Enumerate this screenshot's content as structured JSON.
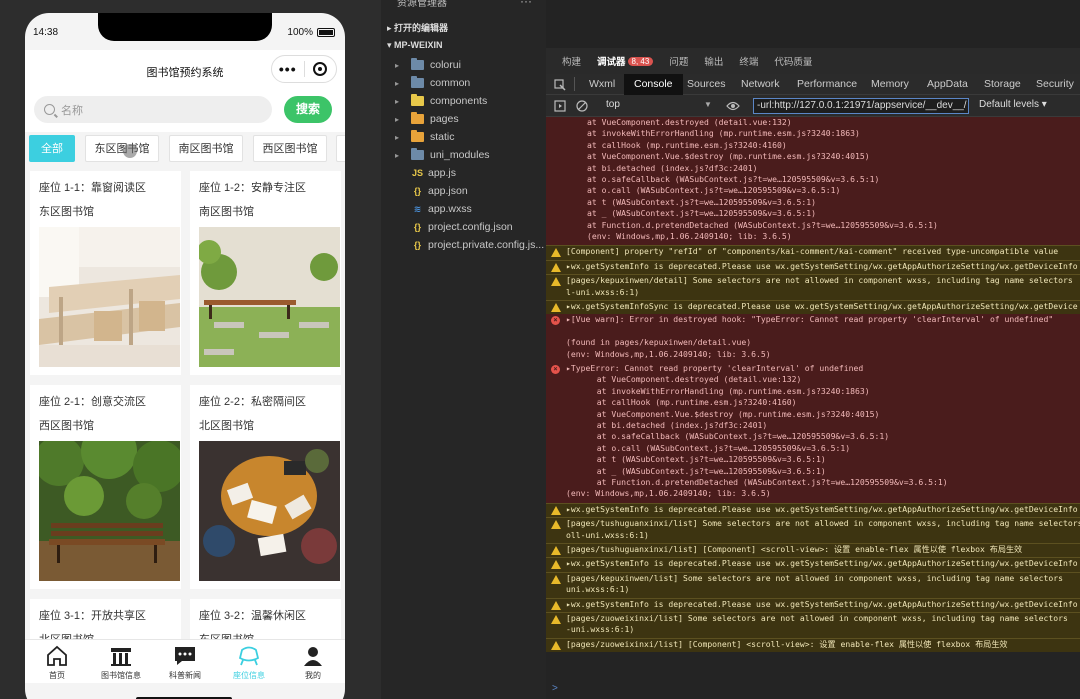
{
  "phone": {
    "time": "14:38",
    "battery": "100%",
    "title": "图书馆预约系统",
    "capsule_more": "•••",
    "search_placeholder": "名称",
    "search_button": "搜索",
    "chips": [
      "全部",
      "东区图书馆",
      "南区图书馆",
      "西区图书馆",
      ""
    ],
    "cards": [
      {
        "title": "座位 1-1：靠窗阅读区",
        "library": "东区图书馆",
        "image": "classroom-chairs"
      },
      {
        "title": "座位 1-2：安静专注区",
        "library": "南区图书馆",
        "image": "garden-bench"
      },
      {
        "title": "座位 2-1：创意交流区",
        "library": "西区图书馆",
        "image": "park-bench"
      },
      {
        "title": "座位 2-2：私密隔间区",
        "library": "北区图书馆",
        "image": "reading-circle"
      },
      {
        "title": "座位 3-1：开放共享区",
        "library": "北区图书馆",
        "image": ""
      },
      {
        "title": "座位 3-2：温馨休闲区",
        "library": "东区图书馆",
        "image": ""
      }
    ],
    "tabs": [
      {
        "label": "首页",
        "icon": "home-icon"
      },
      {
        "label": "图书馆信息",
        "icon": "library-icon"
      },
      {
        "label": "科普新闻",
        "icon": "chat-icon"
      },
      {
        "label": "座位信息",
        "icon": "seat-icon",
        "active": true
      },
      {
        "label": "我的",
        "icon": "user-icon"
      }
    ],
    "accent": "#3ccfe0",
    "button_green": "#3cc468"
  },
  "explorer": {
    "header": "资源管理器",
    "more": "···",
    "sections": [
      "打开的编辑器",
      "MP-WEIXIN"
    ],
    "items": [
      {
        "name": "colorui",
        "type": "folder",
        "color": "#6d8aa8"
      },
      {
        "name": "common",
        "type": "folder",
        "color": "#6d8aa8"
      },
      {
        "name": "components",
        "type": "folder",
        "color": "#e8c84a"
      },
      {
        "name": "pages",
        "type": "folder",
        "color": "#e8a33a"
      },
      {
        "name": "static",
        "type": "folder",
        "color": "#e8a33a"
      },
      {
        "name": "uni_modules",
        "type": "folder",
        "color": "#6d8aa8"
      },
      {
        "name": "app.js",
        "type": "js",
        "color": "#e8c84a"
      },
      {
        "name": "app.json",
        "type": "json",
        "color": "#e8c84a"
      },
      {
        "name": "app.wxss",
        "type": "wxss",
        "color": "#4a90d9"
      },
      {
        "name": "project.config.json",
        "type": "json",
        "color": "#e8c84a"
      },
      {
        "name": "project.private.config.js...",
        "type": "json",
        "color": "#e8c84a"
      }
    ]
  },
  "devtools": {
    "top_tabs": [
      "构建",
      "调试器",
      "问题",
      "输出",
      "终端",
      "代码质量"
    ],
    "error_badge": "8, 43",
    "panel_tabs": [
      "Wxml",
      "Console",
      "Sources",
      "Network",
      "Performance",
      "Memory",
      "AppData",
      "Storage",
      "Security"
    ],
    "context": "top",
    "filter": "-url:http://127.0.0.1:21971/appservice/__dev__/",
    "levels": "Default levels ▾",
    "prompt": ">",
    "messages": [
      {
        "kind": "err",
        "icon": false,
        "lines": [
          "at VueComponent.destroyed (detail.vue:132)",
          "at invokeWithErrorHandling (mp.runtime.esm.js?3240:1863)",
          "at callHook (mp.runtime.esm.js?3240:4160)",
          "at VueComponent.Vue.$destroy (mp.runtime.esm.js?3240:4015)",
          "at bi.detached (index.js?df3c:2401)",
          "at o.safeCallback (WASubContext.js?t=we…120595509&v=3.6.5:1)",
          "at o.call (WASubContext.js?t=we…120595509&v=3.6.5:1)",
          "at t (WASubContext.js?t=we…120595509&v=3.6.5:1)",
          "at _ (WASubContext.js?t=we…120595509&v=3.6.5:1)",
          "at Function.d.pretendDetached (WASubContext.js?t=we…120595509&v=3.6.5:1)",
          "(env: Windows,mp,1.06.2409140; lib: 3.6.5)"
        ]
      },
      {
        "kind": "warn",
        "icon": true,
        "lines": [
          "[Component] property \"refId\" of \"components/kai-comment/kai-comment\" received type-uncompatible value"
        ]
      },
      {
        "kind": "warn",
        "icon": true,
        "lines": [
          "▸wx.getSystemInfo is deprecated.Please use wx.getSystemSetting/wx.getAppAuthorizeSetting/wx.getDeviceInfo"
        ]
      },
      {
        "kind": "warn",
        "icon": true,
        "lines": [
          "[pages/kepuxinwen/detail] Some selectors are not allowed in component wxss, including tag name selectors",
          "l-uni.wxss:6:1)"
        ]
      },
      {
        "kind": "warn",
        "icon": true,
        "lines": [
          "▸wx.getSystemInfoSync is deprecated.Please use wx.getSystemSetting/wx.getAppAuthorizeSetting/wx.getDevice"
        ]
      },
      {
        "kind": "err",
        "icon": true,
        "lines": [
          "▸[Vue warn]: Error in destroyed hook: \"TypeError: Cannot read property 'clearInterval' of undefined\"",
          "",
          "(found in pages/kepuxinwen/detail.vue)",
          "(env: Windows,mp,1.06.2409140; lib: 3.6.5)"
        ]
      },
      {
        "kind": "err",
        "icon": true,
        "lines": [
          "▸TypeError: Cannot read property 'clearInterval' of undefined",
          "  at VueComponent.destroyed (detail.vue:132)",
          "  at invokeWithErrorHandling (mp.runtime.esm.js?3240:1863)",
          "  at callHook (mp.runtime.esm.js?3240:4160)",
          "  at VueComponent.Vue.$destroy (mp.runtime.esm.js?3240:4015)",
          "  at bi.detached (index.js?df3c:2401)",
          "  at o.safeCallback (WASubContext.js?t=we…120595509&v=3.6.5:1)",
          "  at o.call (WASubContext.js?t=we…120595509&v=3.6.5:1)",
          "  at t (WASubContext.js?t=we…120595509&v=3.6.5:1)",
          "  at _ (WASubContext.js?t=we…120595509&v=3.6.5:1)",
          "  at Function.d.pretendDetached (WASubContext.js?t=we…120595509&v=3.6.5:1)",
          "(env: Windows,mp,1.06.2409140; lib: 3.6.5)"
        ]
      },
      {
        "kind": "warn",
        "icon": true,
        "lines": [
          "▸wx.getSystemInfo is deprecated.Please use wx.getSystemSetting/wx.getAppAuthorizeSetting/wx.getDeviceInfo"
        ]
      },
      {
        "kind": "warn",
        "icon": true,
        "lines": [
          "[pages/tushuguanxinxi/list] Some selectors are not allowed in component wxss, including tag name selectors",
          "oll-uni.wxss:6:1)"
        ]
      },
      {
        "kind": "warn",
        "icon": true,
        "lines": [
          "[pages/tushuguanxinxi/list] [Component] <scroll-view>: 设置 enable-flex 属性以使 flexbox 布局生效"
        ]
      },
      {
        "kind": "warn",
        "icon": true,
        "lines": [
          "▸wx.getSystemInfo is deprecated.Please use wx.getSystemSetting/wx.getAppAuthorizeSetting/wx.getDeviceInfo"
        ]
      },
      {
        "kind": "warn",
        "icon": true,
        "lines": [
          "[pages/kepuxinwen/list] Some selectors are not allowed in component wxss, including tag name selectors",
          "uni.wxss:6:1)"
        ]
      },
      {
        "kind": "warn",
        "icon": true,
        "lines": [
          "▸wx.getSystemInfo is deprecated.Please use wx.getSystemSetting/wx.getAppAuthorizeSetting/wx.getDeviceInfo"
        ]
      },
      {
        "kind": "warn",
        "icon": true,
        "lines": [
          "[pages/zuoweixinxi/list] Some selectors are not allowed in component wxss, including tag name selectors",
          "-uni.wxss:6:1)"
        ]
      },
      {
        "kind": "warn",
        "icon": true,
        "lines": [
          "[pages/zuoweixinxi/list] [Component] <scroll-view>: 设置 enable-flex 属性以使 flexbox 布局生效"
        ]
      }
    ]
  }
}
